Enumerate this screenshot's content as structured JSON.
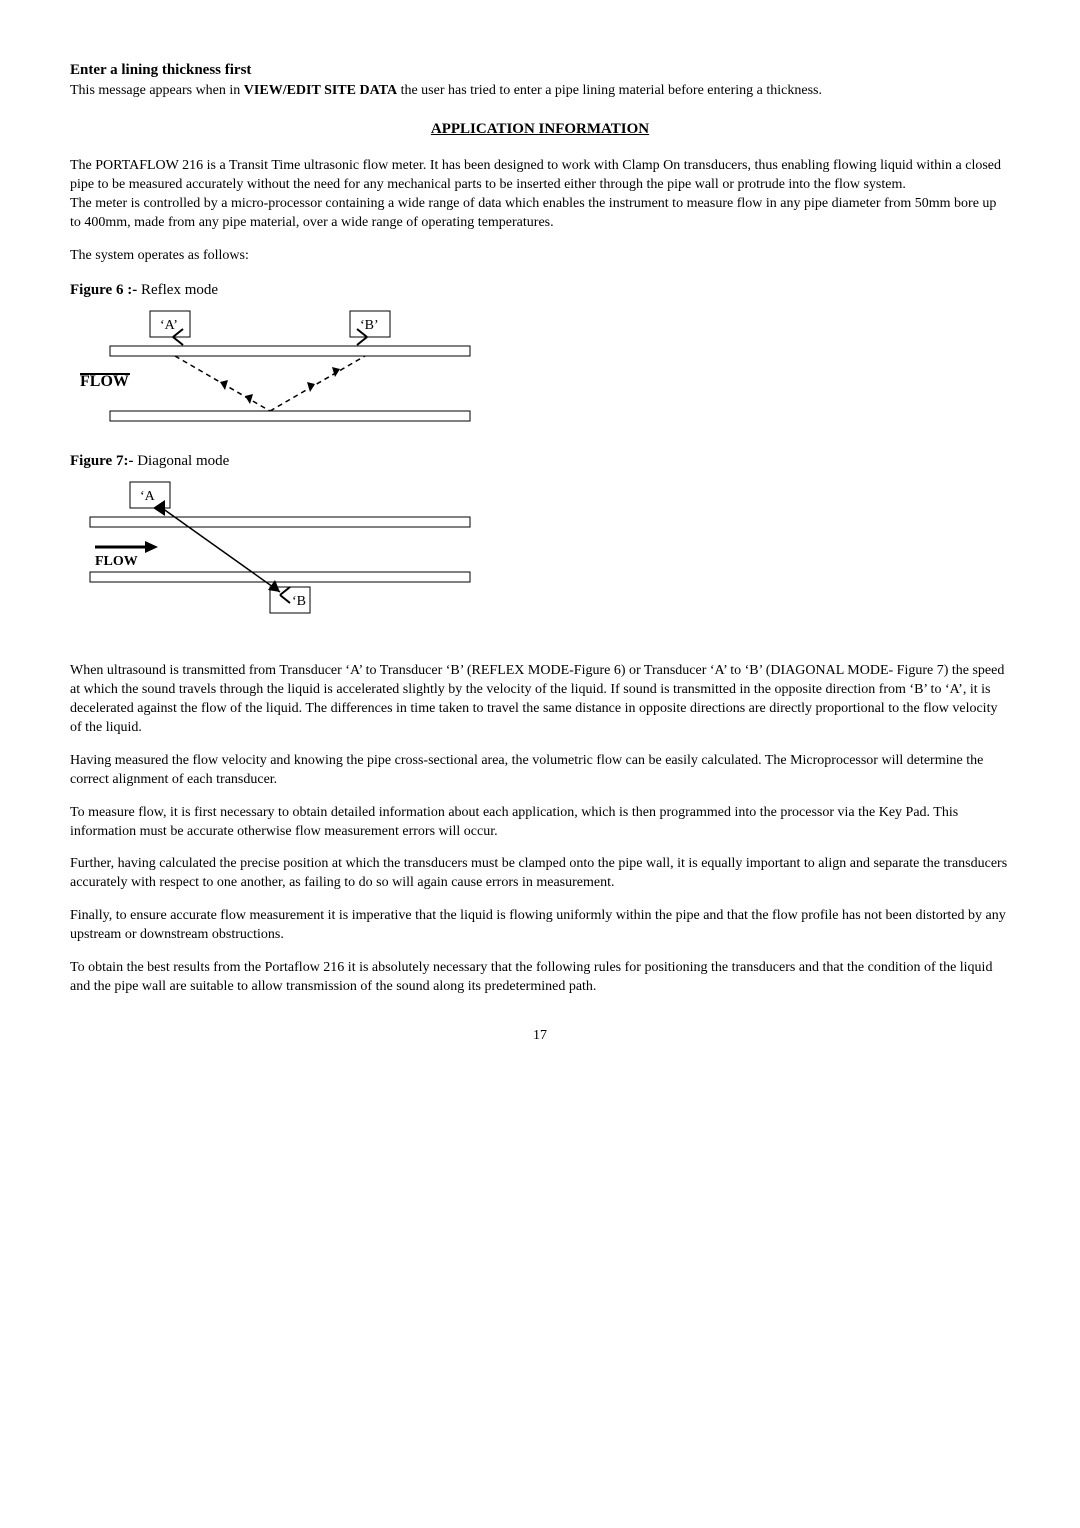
{
  "h1": "Enter a lining thickness first",
  "p1a": "This message appears when in ",
  "p1b": "VIEW/EDIT SITE DATA",
  "p1c": " the user has tried to enter a pipe lining material before entering a thickness.",
  "section_title": "APPLICATION INFORMATION",
  "p2": "The PORTAFLOW 216 is a Transit Time ultrasonic flow meter. It has been designed to work with Clamp On transducers, thus enabling flowing liquid within a closed pipe to be measured accurately without the need for any mechanical parts to be inserted either through the pipe wall or protrude into the flow system.",
  "p3": "The meter is controlled by a micro-processor containing a wide range of data which enables the instrument to measure flow in any pipe diameter from 50mm bore up to 400mm, made from any pipe material, over a wide range of operating temperatures.",
  "p4": "The system operates as follows:",
  "fig6_label": "Figure 6 :-",
  "fig6_desc": " Reflex mode",
  "fig6_A": "‘A’",
  "fig6_B": "‘B’",
  "fig6_flow": "FLOW",
  "fig7_label": "Figure 7:-",
  "fig7_desc": " Diagonal mode",
  "fig7_A": "‘A",
  "fig7_B": "‘B",
  "fig7_flow": "FLOW",
  "p5": "When ultrasound is transmitted from Transducer ‘A’ to Transducer ‘B’ (REFLEX MODE-Figure 6) or Transducer ‘A’ to ‘B’ (DIAGONAL MODE- Figure 7) the speed at which the sound travels through the liquid is accelerated slightly by the velocity of the liquid.  If sound is transmitted in the opposite direction from ‘B’ to ‘A’, it is decelerated against the flow of the liquid.  The differences in time taken to travel the same distance in opposite directions are directly proportional to the flow velocity of the liquid.",
  "p6": "Having measured the flow velocity and knowing the pipe cross-sectional area, the volumetric flow can be easily calculated.  The Microprocessor will determine the correct alignment of each transducer.",
  "p7": "To measure flow, it is first necessary to obtain detailed information about each application, which is then programmed into the processor via the Key Pad. This information must be accurate otherwise flow measurement errors will occur.",
  "p8": "Further, having calculated the precise position at which the transducers must be clamped onto the pipe wall, it is equally important to align and separate the transducers accurately with respect to one another, as failing to do so will again cause errors in measurement.",
  "p9": "Finally, to ensure accurate flow measurement it is imperative that the liquid is flowing uniformly within the pipe and that the flow profile has not been distorted by any upstream or downstream obstructions.",
  "p10": "To obtain the best results from the Portaflow 216 it is absolutely necessary that the following rules for positioning the transducers and that the condition of the liquid and the pipe wall are suitable to allow transmission of the sound along its predetermined path.",
  "page_number": "17"
}
